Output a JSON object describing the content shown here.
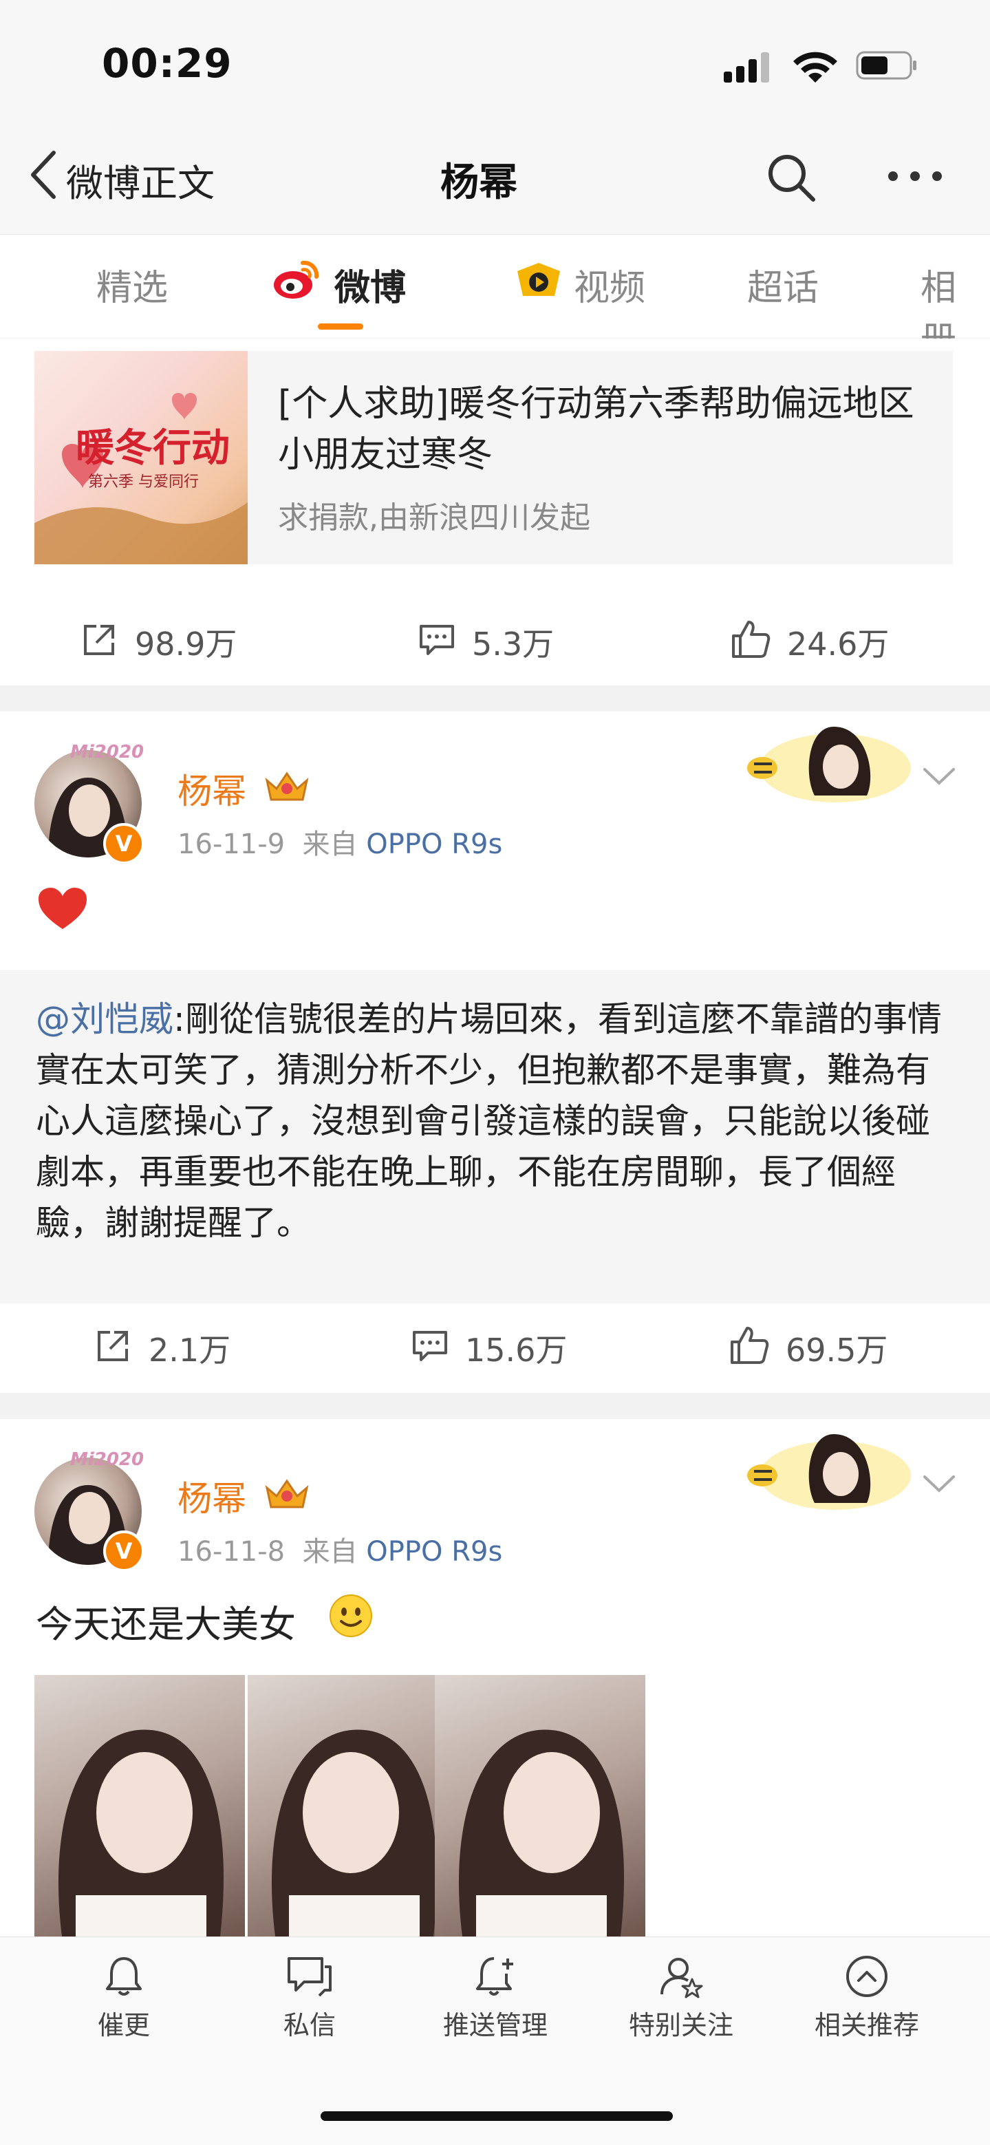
{
  "status_bar": {
    "time": "00:29"
  },
  "nav": {
    "back_label": "微博正文",
    "title": "杨幂"
  },
  "tabs": [
    {
      "label": "精选"
    },
    {
      "label": "微博"
    },
    {
      "label": "视频"
    },
    {
      "label": "超话"
    },
    {
      "label": "相册"
    }
  ],
  "promo": {
    "title": "[个人求助]暖冬行动第六季帮助偏远地区小朋友过寒冬",
    "subtitle": "求捐款,由新浪四川发起",
    "image_text": {
      "main": "暖冬行动",
      "sub": "第六季 与爱同行"
    },
    "shares": "98.9万",
    "comments": "5.3万",
    "likes": "24.6万"
  },
  "posts": [
    {
      "author": "杨幂",
      "date": "16-11-9",
      "source_prefix": "来自",
      "source": "OPPO R9s",
      "avatar_text": "Mi2020",
      "text": "",
      "repost_mention": "@刘恺威",
      "repost_text": ":剛從信號很差的片場回來，看到這麼不靠譜的事情實在太可笑了，猜測分析不少，但抱歉都不是事實，難為有心人這麼操心了，沒想到會引發這樣的誤會，只能說以後碰劇本，再重要也不能在晚上聊，不能在房間聊，長了個經驗，謝謝提醒了。",
      "shares": "2.1万",
      "comments": "15.6万",
      "likes": "69.5万"
    },
    {
      "author": "杨幂",
      "date": "16-11-8",
      "source_prefix": "来自",
      "source": "OPPO R9s",
      "avatar_text": "Mi2020",
      "text": "今天还是大美女"
    }
  ],
  "bottom_bar": [
    {
      "label": "催更",
      "icon": "bell-icon"
    },
    {
      "label": "私信",
      "icon": "message-icon"
    },
    {
      "label": "推送管理",
      "icon": "bell-plus-icon"
    },
    {
      "label": "特别关注",
      "icon": "user-star-icon"
    },
    {
      "label": "相关推荐",
      "icon": "chevron-up-circle-icon"
    }
  ],
  "colors": {
    "accent": "#ff8200",
    "username": "#ec7a18",
    "link": "#4a6fa5"
  }
}
